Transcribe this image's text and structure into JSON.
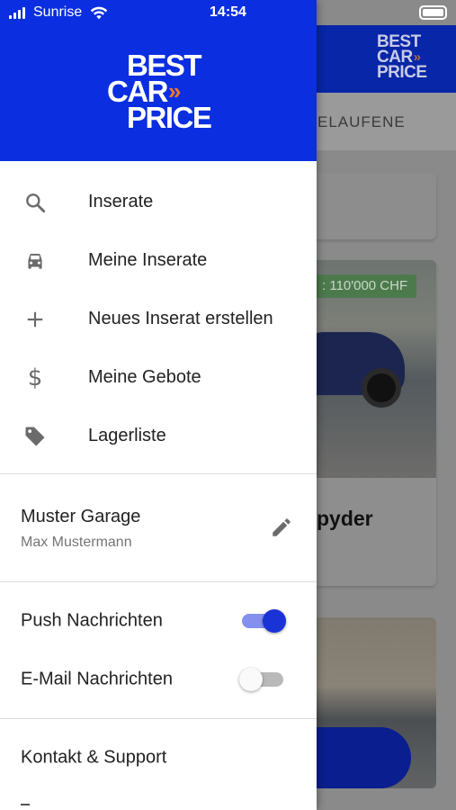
{
  "status_bar": {
    "carrier": "Sunrise",
    "time": "14:54",
    "signal_bars": 4,
    "icons": [
      "signal-icon",
      "wifi-icon",
      "battery-icon"
    ]
  },
  "background": {
    "header_logo": {
      "line1": "BEST",
      "line2": "CAR",
      "line3": "PRICE"
    },
    "tab_label": "ELAUFENE",
    "card_price": ": 110'000 CHF",
    "card_title": "pyder"
  },
  "drawer": {
    "logo": {
      "line1": "BEST",
      "line2": "CAR",
      "chevrons": "»",
      "line3": "PRICE"
    },
    "menu_items": [
      {
        "label": "Inserate",
        "icon": "search-icon"
      },
      {
        "label": "Meine Inserate",
        "icon": "car-icon"
      },
      {
        "label": "Neues Inserat erstellen",
        "icon": "plus-icon"
      },
      {
        "label": "Meine Gebote",
        "icon": "dollar-icon"
      },
      {
        "label": "Lagerliste",
        "icon": "tag-icon"
      }
    ],
    "garage": {
      "name": "Muster Garage",
      "user": "Max Mustermann",
      "edit_icon": "pencil-icon"
    },
    "settings": [
      {
        "label": "Push Nachrichten",
        "enabled": true
      },
      {
        "label": "E-Mail Nachrichten",
        "enabled": false
      }
    ],
    "support_label": "Kontakt & Support"
  },
  "colors": {
    "brand_blue": "#0a2ee0",
    "accent_orange": "#f07a2c",
    "toggle_on": "#1a33d6"
  }
}
